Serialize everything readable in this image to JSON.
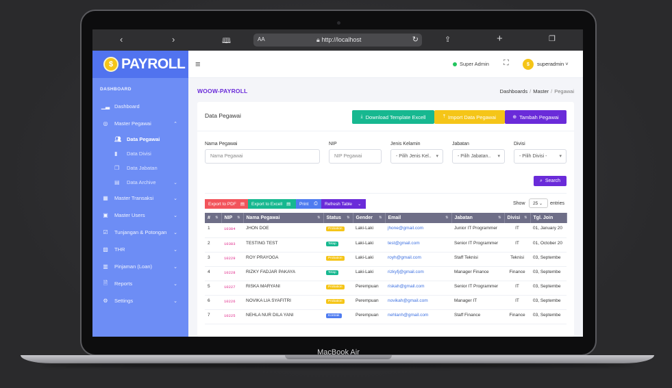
{
  "device": {
    "label": "MacBook Air"
  },
  "browser": {
    "aa_label": "AA",
    "url": "http://localhost",
    "icons": [
      "back-icon",
      "forward-icon",
      "book-icon",
      "lock-icon",
      "reload-icon",
      "share-icon",
      "plus-icon",
      "tabs-icon"
    ]
  },
  "brand": {
    "coin": "$",
    "name": "PAYROLL"
  },
  "sidebar": {
    "section": "DASHBOARD",
    "items": [
      {
        "label": "Dashboard",
        "icon": "chart-icon"
      },
      {
        "label": "Master Pegawai",
        "icon": "user-circle-icon",
        "expanded": true
      },
      {
        "label": "Master Transaksi",
        "icon": "calendar-icon"
      },
      {
        "label": "Master Users",
        "icon": "user-card-icon"
      },
      {
        "label": "Tunjangan & Potongan",
        "icon": "check-square-icon"
      },
      {
        "label": "THR",
        "icon": "bus-icon"
      },
      {
        "label": "Pinjaman (Loan)",
        "icon": "register-icon"
      },
      {
        "label": "Reports",
        "icon": "file-icon"
      },
      {
        "label": "Settings",
        "icon": "gear-icon"
      }
    ],
    "sub_items": [
      {
        "label": "Data Pegawai",
        "icon": "users-icon",
        "active": true
      },
      {
        "label": "Data Divisi",
        "icon": "bookmark-icon"
      },
      {
        "label": "Data Jabatan",
        "icon": "copy-icon"
      },
      {
        "label": "Data Archive",
        "icon": "archive-icon"
      }
    ]
  },
  "header": {
    "role": "Super Admin",
    "avatar": "$",
    "user": "superadmin ˅"
  },
  "page": {
    "title": "WOOW-PAYROLL",
    "breadcrumb": [
      "Dashboards",
      "Master",
      "Pegawai"
    ]
  },
  "card": {
    "title": "Data Pegawai",
    "buttons": {
      "download": "Download Template Excell",
      "import": "Import Data Pegawai",
      "add": "Tambah Pegawai"
    }
  },
  "filters": {
    "nama": {
      "label": "Nama Pegawai",
      "placeholder": "Nama Pegawai"
    },
    "nip": {
      "label": "NIP",
      "placeholder": "NIP Pegawai"
    },
    "jenis": {
      "label": "Jenis Kelamin",
      "value": "- Pilih Jenis Kel.."
    },
    "jabatan": {
      "label": "Jabatan",
      "value": "- Pilih Jabatan.."
    },
    "divisi": {
      "label": "Divisi",
      "value": "- Pilih Divisi -"
    },
    "search": "Search"
  },
  "table_tools": {
    "pdf": "Export to PDF",
    "excel": "Export to Excell",
    "print": "Print",
    "refresh": "Refresh Table",
    "show": "Show",
    "page_size": "25",
    "entries": "entries"
  },
  "table": {
    "columns": [
      "#",
      "NIP",
      "Nama Pegawai",
      "Status",
      "Gender",
      "Email",
      "Jabatan",
      "Divisi",
      "Tgl. Join"
    ],
    "rows": [
      {
        "no": "1",
        "nip": "10384",
        "nama": "JHON DOE",
        "status": "Probation",
        "gender": "Laki-Laki",
        "email": "jhone@gmail.com",
        "jabatan": "Junior IT Programmer",
        "divisi": "IT",
        "join": "01, January 20"
      },
      {
        "no": "2",
        "nip": "10383",
        "nama": "TESTING TEST",
        "status": "Tetap",
        "gender": "Laki-Laki",
        "email": "test@gmail.com",
        "jabatan": "Senior IT Programmer",
        "divisi": "IT",
        "join": "01, October 20"
      },
      {
        "no": "3",
        "nip": "10229",
        "nama": "ROY PRAYOGA",
        "status": "Probation",
        "gender": "Laki-Laki",
        "email": "royh@gmail.com",
        "jabatan": "Staff Teknisi",
        "divisi": "Teknisi",
        "join": "03, Septembe"
      },
      {
        "no": "4",
        "nip": "10228",
        "nama": "RIZKY FADJAR PAKAYA",
        "status": "Tetap",
        "gender": "Laki-Laki",
        "email": "rizkyfj@gmail.com",
        "jabatan": "Manager Finance",
        "divisi": "Finance",
        "join": "03, Septembe"
      },
      {
        "no": "5",
        "nip": "10227",
        "nama": "RISKA MARYANI",
        "status": "Probation",
        "gender": "Perempuan",
        "email": "riskah@gmail.com",
        "jabatan": "Senior IT Programmer",
        "divisi": "IT",
        "join": "03, Septembe"
      },
      {
        "no": "6",
        "nip": "10226",
        "nama": "NOVIKA LIA SYAFITRI",
        "status": "Probation",
        "gender": "Perempuan",
        "email": "novikah@gmail.com",
        "jabatan": "Manager IT",
        "divisi": "IT",
        "join": "03, Septembe"
      },
      {
        "no": "7",
        "nip": "10225",
        "nama": "NEHLA NUR DILA YANI",
        "status": "Kontrak",
        "gender": "Perempuan",
        "email": "nehlanh@gmail.com",
        "jabatan": "Staff Finance",
        "divisi": "Finance",
        "join": "03, Septembe"
      }
    ]
  },
  "colors": {
    "sidebar": "#6d8df5",
    "accent": "#6a2bd9",
    "download": "#17b890",
    "import": "#f5c518",
    "probation": "#f5c518",
    "tetap": "#17b890",
    "kontrak": "#4f7cf0"
  }
}
